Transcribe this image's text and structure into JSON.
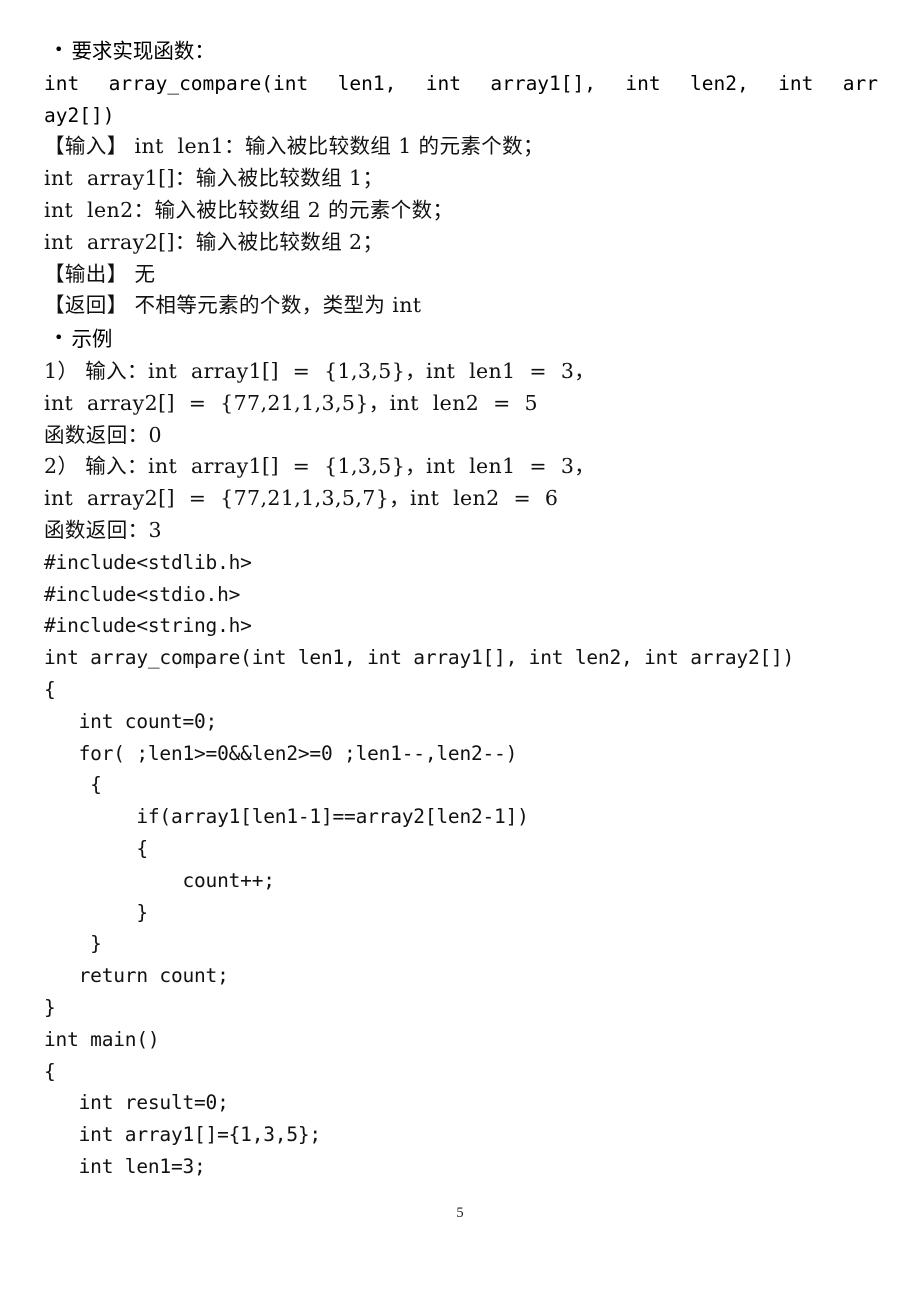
{
  "document": {
    "page_number": "5",
    "bullet_marker": "•",
    "sections": [
      {
        "id": "requirement-heading",
        "kind": "bullet",
        "text": "要求实现函数："
      },
      {
        "id": "function-signature",
        "kind": "signature-justified",
        "text": "int array_compare(int len1, int array1[], int len2, int arr"
      },
      {
        "id": "function-signature-cont",
        "kind": "code-plain",
        "text": "ay2[])"
      },
      {
        "id": "input-label-line",
        "kind": "prose",
        "text": "【输入】 int  len1：输入被比较数组 1 的元素个数；"
      },
      {
        "id": "input-array1-line",
        "kind": "prose",
        "text": "int  array1[]：输入被比较数组 1；"
      },
      {
        "id": "input-len2-line",
        "kind": "prose",
        "text": "int  len2：输入被比较数组 2 的元素个数；"
      },
      {
        "id": "input-array2-line",
        "kind": "prose",
        "text": "int  array2[]：输入被比较数组 2；"
      },
      {
        "id": "output-line",
        "kind": "prose",
        "text": "【输出】 无"
      },
      {
        "id": "return-line",
        "kind": "prose",
        "text": "【返回】 不相等元素的个数，类型为 int"
      },
      {
        "id": "example-heading",
        "kind": "bullet",
        "text": "示例"
      },
      {
        "id": "example1-line1",
        "kind": "prose-spread",
        "text": "1） 输入：int  array1[]  =  {1,3,5}，int  len1  =  3，"
      },
      {
        "id": "example1-line2",
        "kind": "prose-spread",
        "text": "int  array2[]  =  {77,21,1,3,5}，int  len2  =  5"
      },
      {
        "id": "example1-return",
        "kind": "prose",
        "text": "函数返回：0"
      },
      {
        "id": "example2-line1",
        "kind": "prose-spread",
        "text": "2） 输入：int  array1[]  =  {1,3,5}，int  len1  =  3，"
      },
      {
        "id": "example2-line2",
        "kind": "prose-spread",
        "text": "int  array2[]  =  {77,21,1,3,5,7}，int  len2  =  6"
      },
      {
        "id": "example2-return",
        "kind": "prose",
        "text": "函数返回：3"
      }
    ],
    "code_lines": [
      {
        "id": "include-stdlib",
        "text": "#include<stdlib.h>"
      },
      {
        "id": "include-stdio",
        "text": "#include<stdio.h>"
      },
      {
        "id": "include-string",
        "text": "#include<string.h>"
      },
      {
        "id": "func-def",
        "text": "int array_compare(int len1, int array1[], int len2, int array2[])"
      },
      {
        "id": "func-open-brace",
        "text": "{"
      },
      {
        "id": "decl-count",
        "text": "   int count=0;"
      },
      {
        "id": "for-statement",
        "text": "   for( ;len1>=0&&len2>=0 ;len1--,len2--)"
      },
      {
        "id": "for-open-brace",
        "text": "    {"
      },
      {
        "id": "if-statement",
        "text": "        if(array1[len1-1]==array2[len2-1])"
      },
      {
        "id": "if-open-brace",
        "text": "        {"
      },
      {
        "id": "count-increment",
        "text": "            count++;"
      },
      {
        "id": "if-close-brace",
        "text": "        }"
      },
      {
        "id": "for-close-brace",
        "text": "    }"
      },
      {
        "id": "return-count",
        "text": "   return count;"
      },
      {
        "id": "func-close-brace",
        "text": "}"
      },
      {
        "id": "main-def",
        "text": "int main()"
      },
      {
        "id": "main-open-brace",
        "text": "{"
      },
      {
        "id": "decl-result",
        "text": "   int result=0;"
      },
      {
        "id": "decl-array1",
        "text": "   int array1[]={1,3,5};"
      },
      {
        "id": "decl-len1",
        "text": "   int len1=3;"
      }
    ]
  }
}
